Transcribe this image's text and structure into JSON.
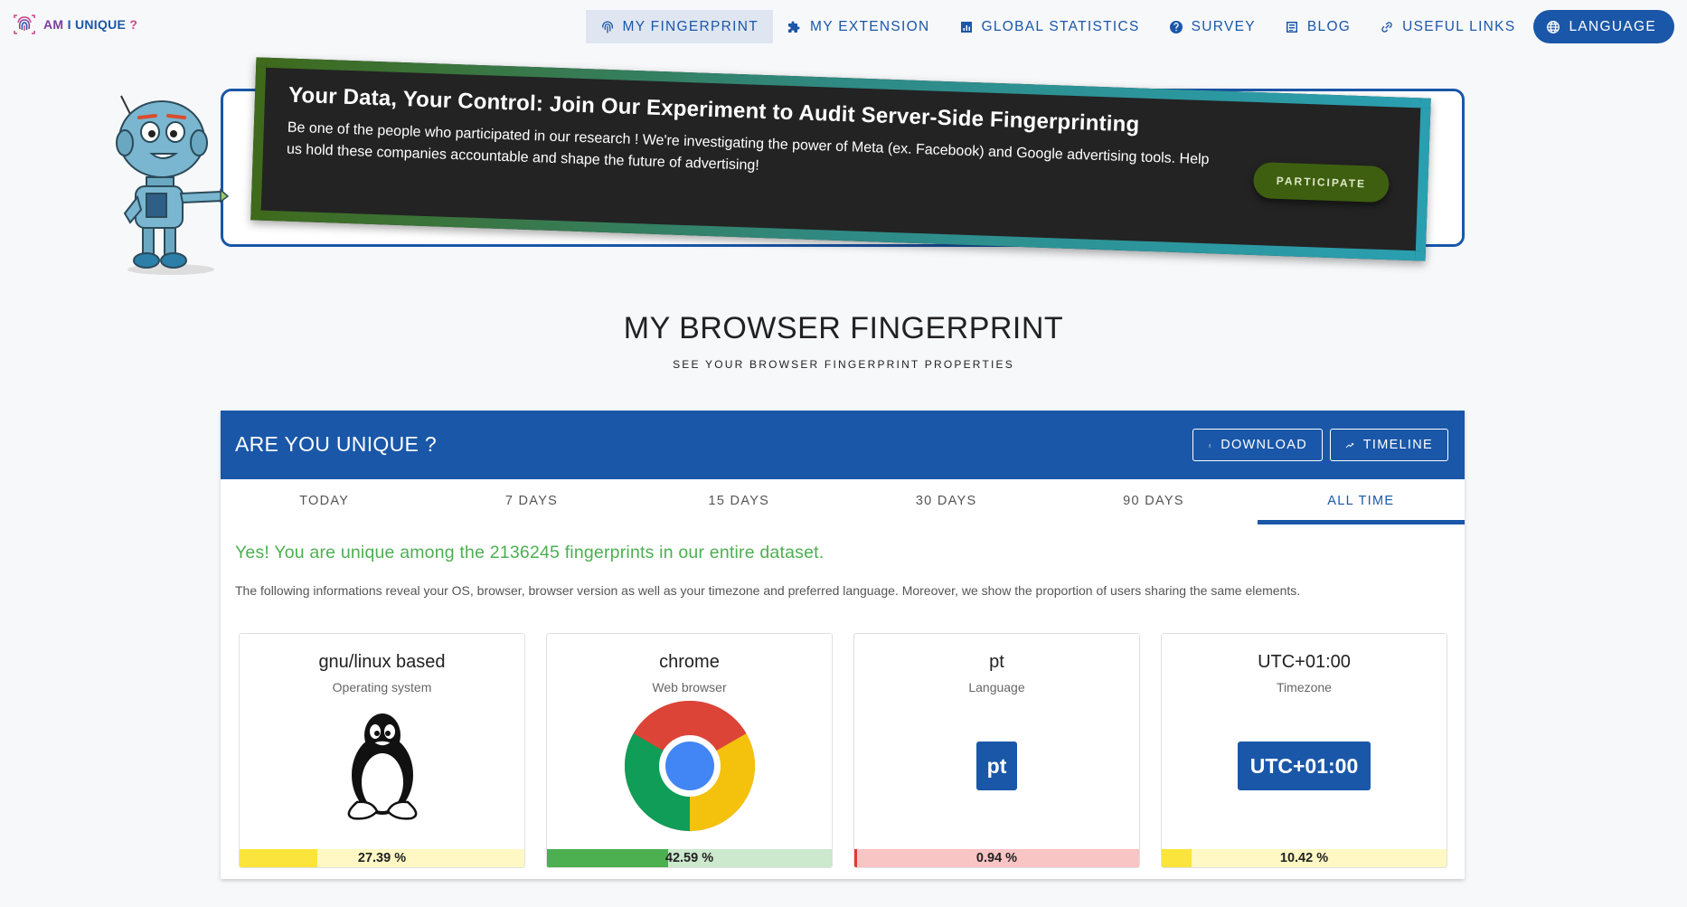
{
  "nav": {
    "logo_text": {
      "part1": "AM ",
      "part2": "I UNIQUE",
      "part3": " ?"
    },
    "items": [
      {
        "label": "MY FINGERPRINT",
        "icon": "fingerprint-icon"
      },
      {
        "label": "MY EXTENSION",
        "icon": "puzzle-icon"
      },
      {
        "label": "GLOBAL STATISTICS",
        "icon": "chart-icon"
      },
      {
        "label": "SURVEY",
        "icon": "help-circle-icon"
      },
      {
        "label": "BLOG",
        "icon": "blog-icon"
      },
      {
        "label": "USEFUL LINKS",
        "icon": "link-icon"
      },
      {
        "label": "LANGUAGE",
        "icon": "globe-icon"
      }
    ]
  },
  "banner": {
    "title": "Your Data, Your Control: Join Our Experiment to Audit Server-Side Fingerprinting",
    "text": "Be one of the people who participated in our research ! We're investigating the power of Meta (ex. Facebook) and Google advertising tools. Help us hold these companies accountable and shape the future of advertising!",
    "button": "PARTICIPATE"
  },
  "heading": {
    "title": "MY BROWSER FINGERPRINT",
    "subtitle": "SEE YOUR BROWSER FINGERPRINT PROPERTIES"
  },
  "card": {
    "title": "ARE YOU UNIQUE ?",
    "download": "DOWNLOAD",
    "timeline": "TIMELINE",
    "tabs": [
      "TODAY",
      "7 DAYS",
      "15 DAYS",
      "30 DAYS",
      "90 DAYS",
      "ALL TIME"
    ],
    "active_tab": "ALL TIME",
    "unique_message": "Yes! You are unique among the 2136245 fingerprints in our entire dataset.",
    "info": "The following informations reveal your OS, browser, browser version as well as your timezone and preferred language. Moreover, we show the proportion of users sharing the same elements."
  },
  "properties": [
    {
      "value": "gnu/linux based",
      "label": "Operating system",
      "percent_text": "27.39 %",
      "percent": 27.39,
      "fill_color": "#fbe43b",
      "bg_color": "#fff8c4",
      "icon": "linux-tux-icon"
    },
    {
      "value": "chrome",
      "label": "Web browser",
      "percent_text": "42.59 %",
      "percent": 42.59,
      "fill_color": "#4caf50",
      "bg_color": "#cce8cd",
      "icon": "chrome-logo-icon"
    },
    {
      "value": "pt",
      "label": "Language",
      "percent_text": "0.94 %",
      "percent": 0.94,
      "fill_color": "#e53935",
      "bg_color": "#f9c4c4",
      "chip": "pt"
    },
    {
      "value": "UTC+01:00",
      "label": "Timezone",
      "percent_text": "10.42 %",
      "percent": 10.42,
      "fill_color": "#fbe43b",
      "bg_color": "#fff8c4",
      "chip": "UTC+01:00"
    }
  ],
  "colors": {
    "primary": "#1a57a8",
    "success": "#4caf50",
    "banner_bg": "#232323"
  }
}
